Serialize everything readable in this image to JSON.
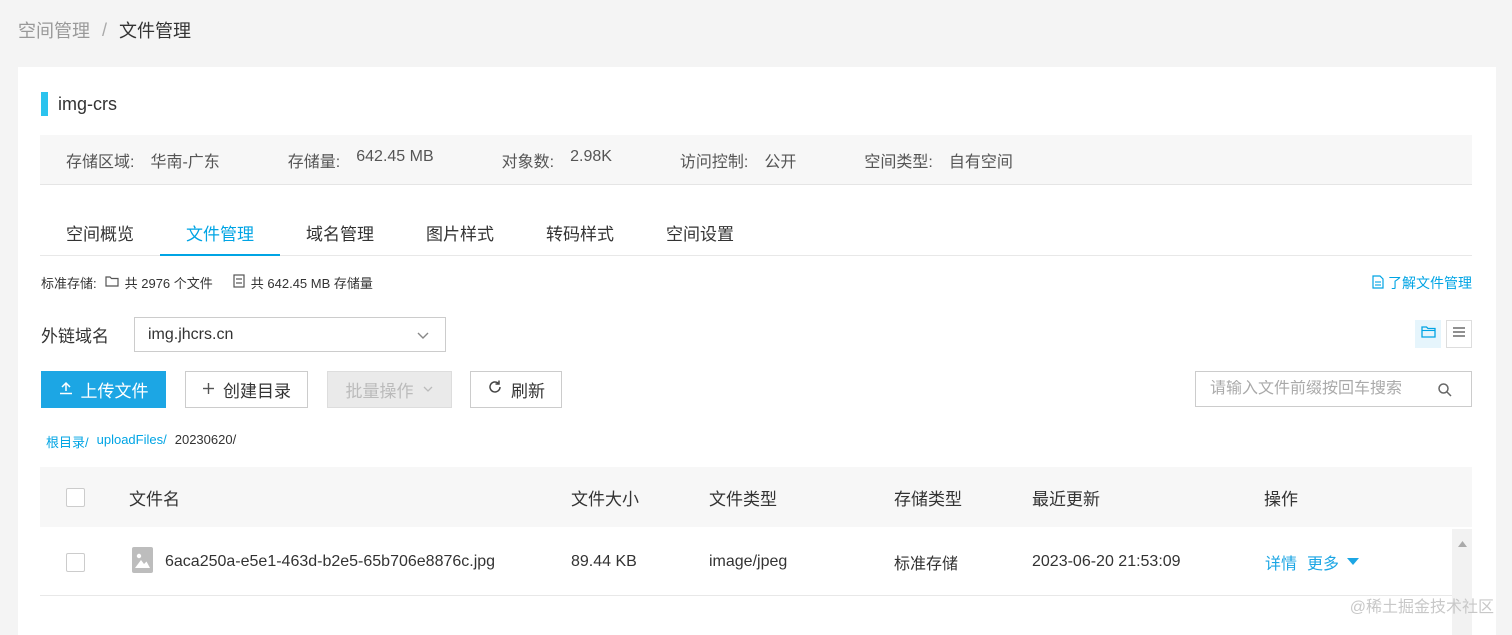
{
  "breadcrumb": {
    "root": "空间管理",
    "sep": "/",
    "current": "文件管理"
  },
  "bucket": {
    "name": "img-crs"
  },
  "info": [
    {
      "key": "存储区域:",
      "value": "华南-广东"
    },
    {
      "key": "存储量:",
      "value": "642.45 MB"
    },
    {
      "key": "对象数:",
      "value": "2.98K"
    },
    {
      "key": "访问控制:",
      "value": "公开"
    },
    {
      "key": "空间类型:",
      "value": "自有空间"
    }
  ],
  "tabs": [
    {
      "label": "空间概览"
    },
    {
      "label": "文件管理",
      "active": true
    },
    {
      "label": "域名管理"
    },
    {
      "label": "图片样式"
    },
    {
      "label": "转码样式"
    },
    {
      "label": "空间设置"
    }
  ],
  "stats": {
    "label": "标准存储:",
    "files": "共 2976 个文件",
    "storage": "共 642.45 MB 存储量"
  },
  "doc_link": "了解文件管理",
  "domain": {
    "label": "外链域名",
    "value": "img.jhcrs.cn"
  },
  "toolbar": {
    "upload": "上传文件",
    "mkdir": "创建目录",
    "batch": "批量操作",
    "refresh": "刷新"
  },
  "search": {
    "placeholder": "请输入文件前缀按回车搜索"
  },
  "path": {
    "root": "根目录/",
    "folder": "uploadFiles/",
    "current": "20230620/"
  },
  "table": {
    "columns": {
      "name": "文件名",
      "size": "文件大小",
      "type": "文件类型",
      "storage": "存储类型",
      "updated": "最近更新",
      "ops": "操作"
    },
    "rows": [
      {
        "name": "6aca250a-e5e1-463d-b2e5-65b706e8876c.jpg",
        "size": "89.44 KB",
        "type": "image/jpeg",
        "storage": "标准存储",
        "updated": "2023-06-20 21:53:09",
        "details": "详情",
        "more": "更多"
      }
    ]
  },
  "watermark": "@稀土掘金技术社区",
  "colors": {
    "accent": "#00a4e4",
    "primary_button": "#1ca6e4",
    "title_bar": "#2bc3ee"
  }
}
